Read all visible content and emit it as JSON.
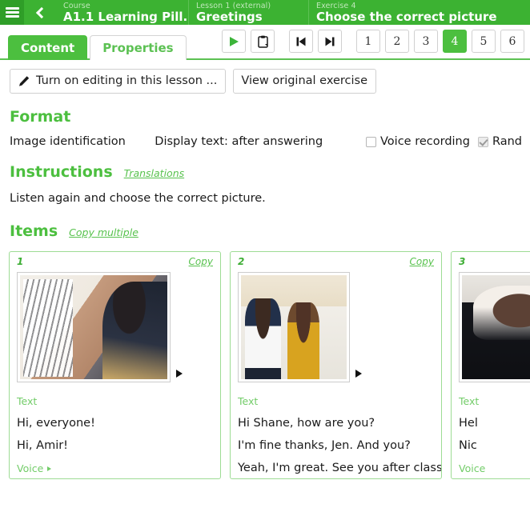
{
  "header": {
    "menu_icon": "hamburger-icon",
    "back_icon": "chevron-left-icon",
    "crumbs": [
      {
        "label": "Course",
        "value": "A1.1 Learning Pill..."
      },
      {
        "label": "Lesson 1 (external)",
        "value": "Greetings"
      },
      {
        "label": "Exercise 4",
        "value": "Choose the correct picture"
      }
    ]
  },
  "toolbar": {
    "tabs": [
      {
        "label": "Content",
        "active": true
      },
      {
        "label": "Properties",
        "active": false
      }
    ],
    "buttons": [
      {
        "name": "play-button",
        "icon": "play-icon"
      },
      {
        "name": "clipboard-button",
        "icon": "clipboard-icon"
      },
      {
        "name": "first-page-button",
        "icon": "skip-to-start-icon"
      },
      {
        "name": "last-page-button",
        "icon": "skip-to-end-icon"
      }
    ],
    "pages": [
      "1",
      "2",
      "3",
      "4",
      "5",
      "6"
    ],
    "active_page": "4"
  },
  "actions": {
    "edit_button": "Turn on editing in this lesson ...",
    "edit_icon": "pencil-icon",
    "view_original_button": "View original exercise"
  },
  "format": {
    "heading": "Format",
    "type": "Image identification",
    "display_text": "Display text: after answering",
    "voice_recording": {
      "label": "Voice recording",
      "checked": false
    },
    "randomize": {
      "label": "Rand",
      "checked": true,
      "disabled": true
    }
  },
  "instructions": {
    "heading": "Instructions",
    "translations_link": "Translations",
    "text": "Listen again and choose the correct picture."
  },
  "items": {
    "heading": "Items",
    "copy_multiple_link": "Copy multiple",
    "copy_link": "Copy",
    "text_label": "Text",
    "voice_label": "Voice",
    "cards": [
      {
        "number": "1",
        "photo": "photo1",
        "lines": [
          "Hi, everyone!",
          "Hi, Amir!"
        ]
      },
      {
        "number": "2",
        "photo": "photo2",
        "lines": [
          "Hi Shane, how are you?",
          "I'm fine thanks, Jen. And you?",
          "Yeah, I'm great. See you after class!"
        ]
      },
      {
        "number": "3",
        "photo": "photo3",
        "lines": [
          "Hel",
          "Nic"
        ]
      }
    ]
  },
  "colors": {
    "brand_green": "#3cb232",
    "accent_green": "#4cbf3f",
    "light_green": "#72cc68",
    "card_border": "#9ddc94"
  }
}
